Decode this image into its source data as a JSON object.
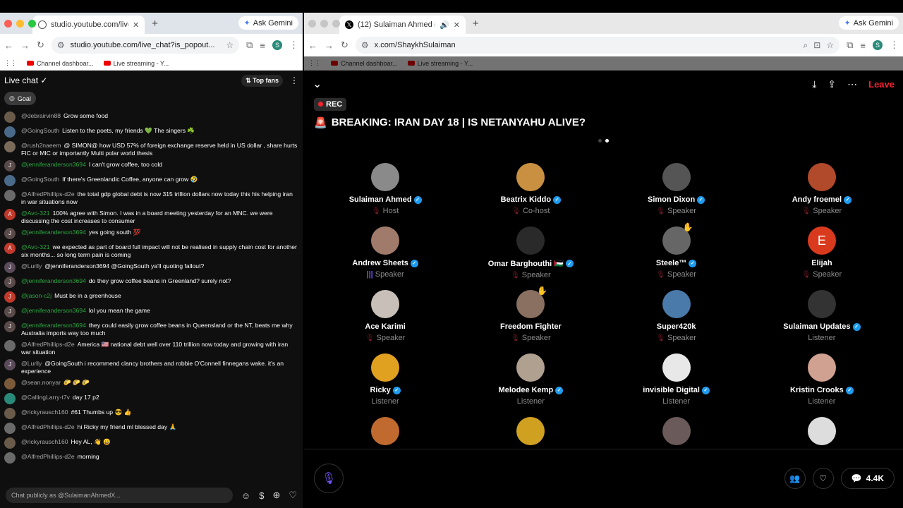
{
  "left": {
    "tab_title": "studio.youtube.com/live_chat",
    "url": "studio.youtube.com/live_chat?is_popout...",
    "ask_gemini": "Ask Gemini",
    "bookmarks": [
      "Channel dashboar...",
      "Live streaming - Y..."
    ],
    "chat_title": "Live chat",
    "top_fans": "Top fans",
    "goal": "Goal",
    "input_placeholder": "Chat publicly as @SulaimanAhmedX...",
    "messages": [
      {
        "user": "@debrairvin88",
        "text": "Grow some food",
        "color": "#6a5a4a",
        "initial": "",
        "green": false
      },
      {
        "user": "@GoingSouth",
        "text": "Listen to the poets, my friends 💚 The singers ☘️",
        "color": "#4a6a8a",
        "initial": "",
        "green": false
      },
      {
        "user": "@rush2naeem",
        "text": "@ SIMON@ how USD 57% of foreign exchange reserve held in US dollar , share hurts FIC or MIC or importantly Multi polar world thesis",
        "color": "#7a6a5a",
        "initial": "",
        "green": false
      },
      {
        "user": "@jenniferanderson3694",
        "text": "I can't grow coffee, too cold",
        "color": "#5a4a4a",
        "initial": "J",
        "green": true
      },
      {
        "user": "@GoingSouth",
        "text": "If there's Greenlandic Coffee, anyone can grow 🤣",
        "color": "#4a6a8a",
        "initial": "",
        "green": false
      },
      {
        "user": "@AlfredPhillips-d2e",
        "text": "the total gdp global debt is now 315 trillion dollars now today this his helping iran in war situations now",
        "color": "#6a6a6a",
        "initial": "",
        "green": false
      },
      {
        "user": "@Avo-321",
        "text": "100% agree with Simon. I was in a board meeting yesterday for an MNC. we were discussing the cost increases to consumer",
        "color": "#c0392b",
        "initial": "A",
        "green": true
      },
      {
        "user": "@jenniferanderson3694",
        "text": "yes going south 💯",
        "color": "#5a4a4a",
        "initial": "J",
        "green": true
      },
      {
        "user": "@Avo-321",
        "text": "we expected as part of board full impact will not be realised in supply chain cost for another six months... so long term pain is coming",
        "color": "#c0392b",
        "initial": "A",
        "green": true
      },
      {
        "user": "@Lurlly",
        "text": "@jenniferanderson3694 @GoingSouth ya'll quoting fallout?",
        "color": "#5a4a5a",
        "initial": "J",
        "green": false
      },
      {
        "user": "@jenniferanderson3694",
        "text": "do they grow coffee beans in Greenland? surely not?",
        "color": "#5a4a4a",
        "initial": "J",
        "green": true
      },
      {
        "user": "@jason-c2j",
        "text": "Must be in a greenhouse",
        "color": "#c0392b",
        "initial": "J",
        "green": true
      },
      {
        "user": "@jenniferanderson3694",
        "text": "lol you mean the game",
        "color": "#5a4a4a",
        "initial": "J",
        "green": true
      },
      {
        "user": "@jenniferanderson3694",
        "text": "they could easily grow coffee beans in Queensland or the NT, beats me why Australia imports way too much",
        "color": "#5a4a4a",
        "initial": "J",
        "green": true
      },
      {
        "user": "@AlfredPhillips-d2e",
        "text": "America 🇺🇸 national debt well over 110 trillion now today and growing with iran war situation",
        "color": "#6a6a6a",
        "initial": "",
        "green": false
      },
      {
        "user": "@Lurlly",
        "text": "@GoingSouth i recommend clancy brothers and robbie O'Connell finnegans wake. it's an experience",
        "color": "#5a4a5a",
        "initial": "J",
        "green": false
      },
      {
        "user": "@sean.nonyar",
        "text": "🌮 🌮 🌮",
        "color": "#7a5a3a",
        "initial": "",
        "green": false
      },
      {
        "user": "@CallingLarry-t7v",
        "text": "day 17 p2",
        "color": "#2a8a7a",
        "initial": "",
        "green": false
      },
      {
        "user": "@rickyrausch160",
        "text": "#61 Thumbs up 😎 👍",
        "color": "#6a5a4a",
        "initial": "",
        "green": false
      },
      {
        "user": "@AlfredPhillips-d2e",
        "text": "hi Ricky my friend ml blessed day 🙏",
        "color": "#6a6a6a",
        "initial": "",
        "green": false
      },
      {
        "user": "@rickyrausch160",
        "text": "Hey AL, 👋 😀",
        "color": "#6a5a4a",
        "initial": "",
        "green": false
      },
      {
        "user": "@AlfredPhillips-d2e",
        "text": "morning",
        "color": "#6a6a6a",
        "initial": "",
        "green": false
      }
    ]
  },
  "right": {
    "tab_title": "(12) Sulaiman Ahmed (@S",
    "url": "x.com/ShaykhSulaiman",
    "ask_gemini": "Ask Gemini",
    "bookmarks": [
      "Channel dashboar...",
      "Live streaming - Y..."
    ],
    "leave": "Leave",
    "rec": "REC",
    "title": "BREAKING: IRAN DAY 18 | IS NETANYAHU ALIVE?",
    "comment_count": "4.4K",
    "people": [
      {
        "name": "Sulaiman Ahmed",
        "role": "Host",
        "verified": true,
        "color": "#8a8a8a",
        "initial": "",
        "hand": false,
        "speaking": false,
        "listener": false
      },
      {
        "name": "Beatrix Kiddo",
        "role": "Co-host",
        "verified": true,
        "color": "#c89040",
        "initial": "",
        "hand": false,
        "speaking": false,
        "listener": false
      },
      {
        "name": "Simon Dixon",
        "role": "Speaker",
        "verified": true,
        "color": "#555",
        "initial": "",
        "hand": false,
        "speaking": false,
        "listener": false
      },
      {
        "name": "Andy froemel",
        "role": "Speaker",
        "verified": true,
        "color": "#b04a2a",
        "initial": "",
        "hand": false,
        "speaking": false,
        "listener": false
      },
      {
        "name": "Andrew Sheets",
        "role": "Speaker",
        "verified": true,
        "color": "#a07a6a",
        "initial": "",
        "hand": false,
        "speaking": true,
        "listener": false
      },
      {
        "name": "Omar Barghouthi 🇵🇸",
        "role": "Speaker",
        "verified": true,
        "color": "#2a2a2a",
        "initial": "",
        "hand": false,
        "speaking": false,
        "listener": false
      },
      {
        "name": "Steele™",
        "role": "Speaker",
        "verified": true,
        "color": "#666",
        "initial": "",
        "hand": true,
        "speaking": false,
        "listener": false
      },
      {
        "name": "Elijah",
        "role": "Speaker",
        "verified": false,
        "color": "#d93a1e",
        "initial": "E",
        "hand": false,
        "speaking": false,
        "listener": false
      },
      {
        "name": "Ace Karimi",
        "role": "Speaker",
        "verified": false,
        "color": "#c8c0b8",
        "initial": "",
        "hand": false,
        "speaking": false,
        "listener": false
      },
      {
        "name": "Freedom Fighter",
        "role": "Speaker",
        "verified": false,
        "color": "#8a7060",
        "initial": "",
        "hand": true,
        "speaking": false,
        "listener": false
      },
      {
        "name": "Super420k",
        "role": "Speaker",
        "verified": false,
        "color": "#4a7aaa",
        "initial": "",
        "hand": false,
        "speaking": false,
        "listener": false
      },
      {
        "name": "Sulaiman Updates",
        "role": "Listener",
        "verified": true,
        "color": "#333",
        "initial": "",
        "hand": false,
        "speaking": false,
        "listener": true
      },
      {
        "name": "Ricky",
        "role": "Listener",
        "verified": true,
        "color": "#e0a020",
        "initial": "",
        "hand": false,
        "speaking": false,
        "listener": true
      },
      {
        "name": "Melodee Kemp",
        "role": "Listener",
        "verified": true,
        "color": "#b0a090",
        "initial": "",
        "hand": false,
        "speaking": false,
        "listener": true
      },
      {
        "name": "invisible Digital",
        "role": "Listener",
        "verified": true,
        "color": "#e8e8e8",
        "initial": "",
        "hand": false,
        "speaking": false,
        "listener": true
      },
      {
        "name": "Kristin Crooks",
        "role": "Listener",
        "verified": true,
        "color": "#d0a090",
        "initial": "",
        "hand": false,
        "speaking": false,
        "listener": true
      },
      {
        "name": "",
        "role": "",
        "verified": false,
        "color": "#c06a30",
        "initial": "",
        "hand": false,
        "speaking": false,
        "listener": true
      },
      {
        "name": "",
        "role": "",
        "verified": false,
        "color": "#d0a020",
        "initial": "",
        "hand": false,
        "speaking": false,
        "listener": true
      },
      {
        "name": "",
        "role": "",
        "verified": false,
        "color": "#6a5a5a",
        "initial": "",
        "hand": false,
        "speaking": false,
        "listener": true
      },
      {
        "name": "",
        "role": "",
        "verified": false,
        "color": "#ddd",
        "initial": "",
        "hand": false,
        "speaking": false,
        "listener": true
      }
    ]
  }
}
